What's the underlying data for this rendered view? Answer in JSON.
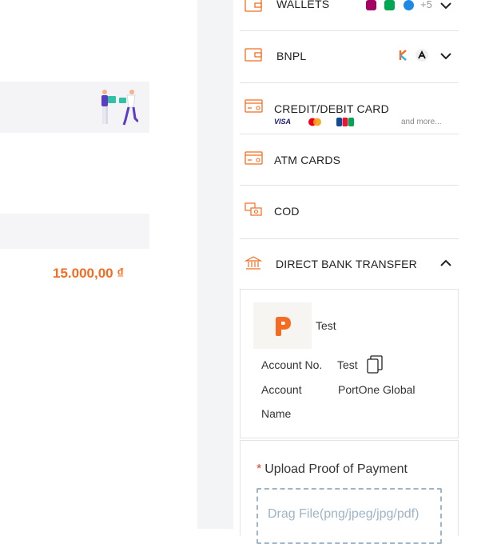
{
  "order": {
    "total_amount": "15.000,00 ₫"
  },
  "payment_methods": [
    {
      "label": "WALLETS",
      "icon": "wallet-icon",
      "extra_count": "+5",
      "expanded": false
    },
    {
      "label": "BNPL",
      "icon": "wallet-icon",
      "expanded": false
    },
    {
      "label": "CREDIT/DEBIT CARD",
      "icon": "card-icon",
      "card_brands": [
        "VISA",
        "mastercard",
        "JCB"
      ],
      "more_text": "and more..."
    },
    {
      "label": "ATM CARDS",
      "icon": "card-icon"
    },
    {
      "label": "COD",
      "icon": "cash-icon"
    },
    {
      "label": "DIRECT BANK TRANSFER",
      "icon": "bank-icon",
      "expanded": true
    }
  ],
  "bank_transfer": {
    "bank_name": "Test",
    "account_no_label": "Account No.",
    "account_no_value": "Test",
    "account_name_label_line1": "Account",
    "account_name_label_line2": "Name",
    "account_name_value": "PortOne Global",
    "upload_label": "Upload Proof of Payment",
    "required_mark": "*",
    "dropzone_text": "Drag File(png/jpeg/jpg/pdf)"
  },
  "colors": {
    "accent": "#f36c21",
    "dropzone": "#9eb5c7",
    "required": "#e53935"
  }
}
